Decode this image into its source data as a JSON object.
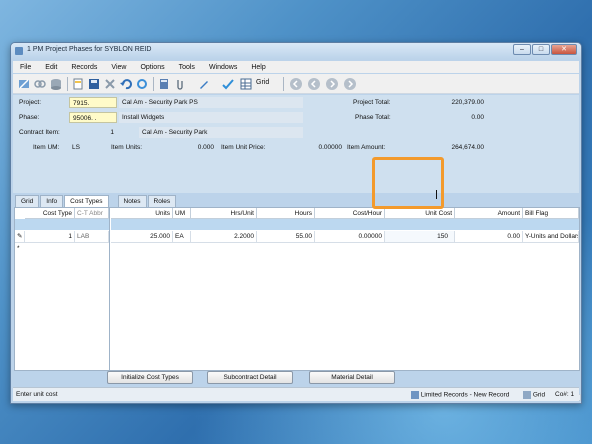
{
  "window": {
    "title": "1 PM Project Phases for SYBLON REID",
    "controls": [
      "minimize",
      "maximize",
      "close"
    ]
  },
  "menubar": [
    "File",
    "Edit",
    "Records",
    "View",
    "Options",
    "Tools",
    "Windows",
    "Help"
  ],
  "toolbar": {
    "grid_label": "Grid",
    "icons": [
      "edit-icon",
      "link-icon",
      "database-icon",
      "document-icon",
      "save-icon",
      "delete-icon",
      "undo-icon",
      "refresh-icon",
      "calculator-icon",
      "attach-icon",
      "pen-icon",
      "spellcheck-icon",
      "grid-icon",
      "first-record-icon",
      "prev-record-icon",
      "next-record-icon",
      "last-record-icon"
    ]
  },
  "header": {
    "project_label": "Project:",
    "project_value": "7915.",
    "project_desc": "Cal Am - Security Park PS",
    "phase_label": "Phase:",
    "phase_value": "95006.  .",
    "phase_desc": "Install Widgets",
    "contract_item_label": "Contract Item:",
    "contract_item_value": "1",
    "contract_item_desc": "Cal Am - Security Park",
    "item_um_label": "Item UM:",
    "item_um_value": "LS",
    "item_units_label": "Item Units:",
    "item_units_value": "0.000",
    "item_unit_price_label": "Item Unit Price:",
    "item_unit_price_value": "0.00000",
    "project_total_label": "Project Total:",
    "project_total_value": "220,379.00",
    "phase_total_label": "Phase Total:",
    "phase_total_value": "0.00",
    "item_amount_label": "Item Amount:",
    "item_amount_value": "264,674.00"
  },
  "tabs": [
    "Grid",
    "Info",
    "Cost Types",
    "Notes",
    "Roles"
  ],
  "active_tab": "Cost Types",
  "left_grid": {
    "headers": [
      "Cost Type",
      "C-T Abbr"
    ],
    "row": {
      "cost_type": "1",
      "ct_abbr": "LAB"
    },
    "new_row_marker": "*"
  },
  "right_grid": {
    "headers": [
      "Units",
      "UM",
      "Hrs/Unit",
      "Hours",
      "Cost/Hour",
      "Unit Cost",
      "Amount",
      "Bill Flag"
    ],
    "row": {
      "units": "25.000",
      "um": "EA",
      "hrs_unit": "2.2000",
      "hours": "55.00",
      "cost_hour": "0.00000",
      "unit_cost": "150",
      "amount": "0.00",
      "bill_flag": "Y-Units and Dollars"
    }
  },
  "buttons": {
    "init_cost_types": "Initialize Cost Types",
    "subcontract_detail": "Subcontract Detail",
    "material_detail": "Material Detail"
  },
  "status": {
    "message": "Enter unit cost",
    "mode": "Limited Records - New Record",
    "view": "Grid",
    "company": "Co#: 1"
  },
  "colors": {
    "highlight": "#f39a2c",
    "required_field": "#fffbc9",
    "grid_band": "#bcd8f0"
  }
}
